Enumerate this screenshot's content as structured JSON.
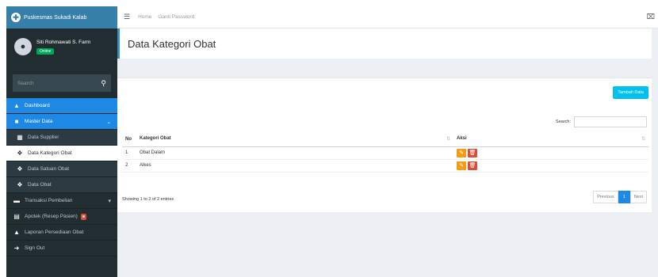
{
  "brand": {
    "title": "Puskesmas Sukadi Kalab"
  },
  "user": {
    "name": "Siti Rohmawati S. Farm",
    "status": "Online"
  },
  "sidebar_search": {
    "placeholder": "Search"
  },
  "menu": {
    "dashboard": "Dashboard",
    "master_data": "Master Data",
    "data_supplier": "Data Supplier",
    "data_kategori_obat": "Data Kategori Obat",
    "data_satuan_obat": "Data Satuan Obat",
    "data_obat": "Data Obat",
    "transaksi_pembelian": "Transaksi Pembelian",
    "apotek_resep_pasien": "Apotek (Resep Pasien)",
    "laporan_persediaan": "Laporan Persediaan Obat",
    "sign_out": "Sign Out"
  },
  "topbar": {
    "home": "Home",
    "ganti_password": "Ganti Password"
  },
  "page": {
    "title": "Data Kategori Obat"
  },
  "card": {
    "add_button": "Tambah Data",
    "search_label": "Search:",
    "columns": {
      "no": "No",
      "kategori": "Kategori Obat",
      "aksi": "Aksi"
    },
    "rows": [
      {
        "no": "1",
        "kategori": "Obat Dalam"
      },
      {
        "no": "2",
        "kategori": "Alkes"
      }
    ],
    "info": "Showing 1 to 2 of 2 entries",
    "pager": {
      "prev": "Previous",
      "current": "1",
      "next": "Next"
    }
  },
  "colors": {
    "accent": "#1e88e5",
    "sidebar": "#222d32",
    "brand": "#367fa9",
    "edit": "#f39c12",
    "delete": "#dd4b39",
    "add": "#00c0ef"
  }
}
